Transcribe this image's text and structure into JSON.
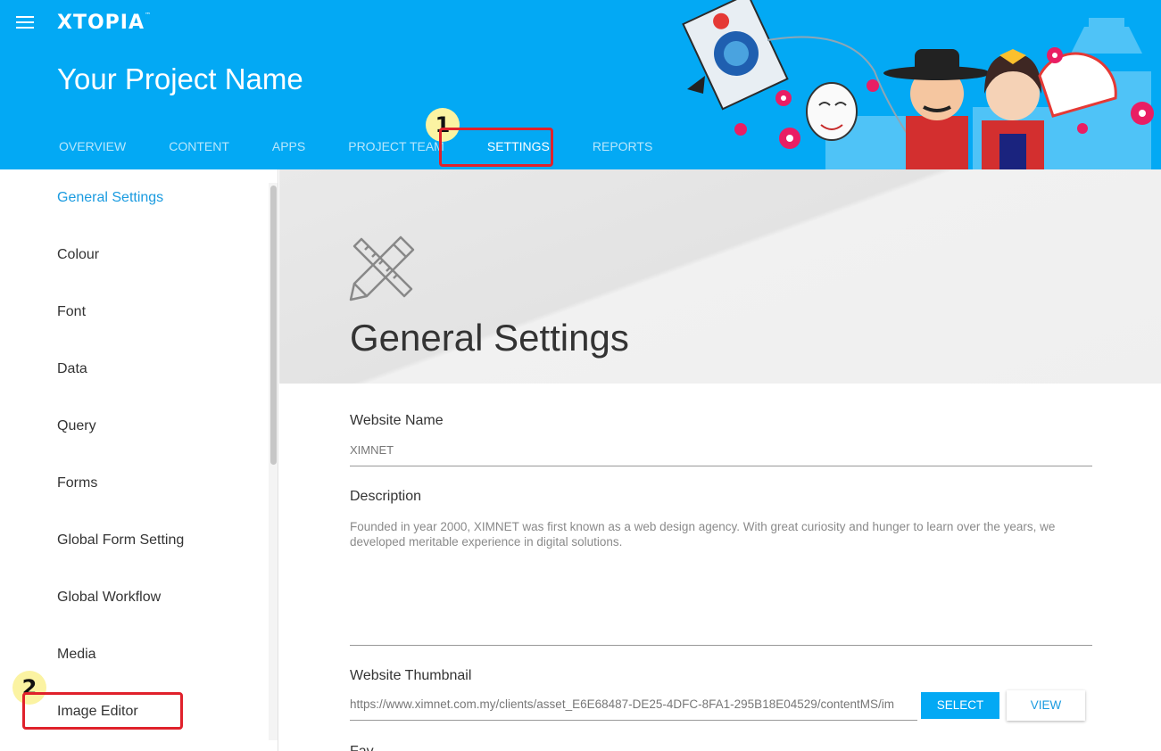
{
  "header": {
    "logo_text": "XTOPIA",
    "logo_tm": "™",
    "project_name": "Your Project Name",
    "tabs": [
      {
        "label": "OVERVIEW"
      },
      {
        "label": "CONTENT"
      },
      {
        "label": "APPS"
      },
      {
        "label": "PROJECT TEAM"
      },
      {
        "label": "SETTINGS"
      },
      {
        "label": "REPORTS"
      }
    ],
    "active_tab": "SETTINGS",
    "accent_color": "#03a9f4"
  },
  "annotations": {
    "badge_1": "1",
    "badge_2": "2",
    "highlight_color": "#e0212b"
  },
  "sidebar": {
    "items": [
      {
        "label": "General Settings"
      },
      {
        "label": "Colour"
      },
      {
        "label": "Font"
      },
      {
        "label": "Data"
      },
      {
        "label": "Query"
      },
      {
        "label": "Forms"
      },
      {
        "label": "Global Form Setting"
      },
      {
        "label": "Global Workflow"
      },
      {
        "label": "Media"
      },
      {
        "label": "Image Editor"
      }
    ],
    "active_item": "General Settings"
  },
  "main": {
    "hero_title": "General Settings",
    "website_name": {
      "label": "Website Name",
      "value": "XIMNET"
    },
    "description": {
      "label": "Description",
      "value": "Founded in year 2000, XIMNET was first known as a web design agency. With great curiosity and hunger to learn over the years, we developed meritable experience in digital solutions."
    },
    "thumbnail": {
      "label": "Website Thumbnail",
      "value": "https://www.ximnet.com.my/clients/asset_E6E68487-DE25-4DFC-8FA1-295B18E04529/contentMS/im",
      "select_label": "SELECT",
      "view_label": "VIEW"
    },
    "next_label_partial": "Fav"
  }
}
